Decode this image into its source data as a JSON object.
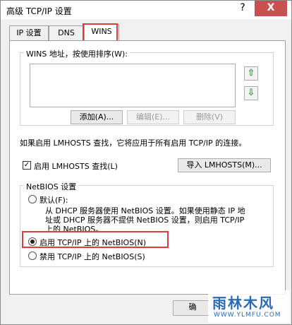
{
  "window": {
    "title": "高级 TCP/IP 设置",
    "help_label": "?",
    "close_label": "X"
  },
  "tabs": [
    {
      "label": "IP 设置"
    },
    {
      "label": "DNS"
    },
    {
      "label": "WINS"
    }
  ],
  "wins": {
    "group_label": "WINS 地址，按使用排序(W):",
    "up_arrow": "⇧",
    "down_arrow": "⇩",
    "add_label": "添加(A)...",
    "edit_label": "编辑(E)...",
    "delete_label": "删除(V)"
  },
  "lmhosts": {
    "info_text": "如果启用 LMHOSTS 查找，它将应用于所有启用 TCP/IP 的连接。",
    "check_mark": "✓",
    "enable_label": "启用 LMHOSTS 查找(L)",
    "import_label": "导入 LMHOSTS(M)..."
  },
  "netbios": {
    "group_label": "NetBIOS 设置",
    "default_label": "默认(F):",
    "default_desc_line1": "从 DHCP 服务器使用 NetBIOS 设置。如果使用静态 IP 地",
    "default_desc_line2": "址或 DHCP 服务器不提供 NetBIOS 设置，则启用 TCP/IP",
    "default_desc_line3": "上的 NetBIOS。",
    "enable_label": "启用 TCP/IP 上的 NetBIOS(N)",
    "disable_label": "禁用 TCP/IP 上的 NetBIOS(S)"
  },
  "footer": {
    "ok_label": "确"
  },
  "watermark": {
    "logo": "雨林木风",
    "url": "WWW.YLMFU.COM"
  }
}
